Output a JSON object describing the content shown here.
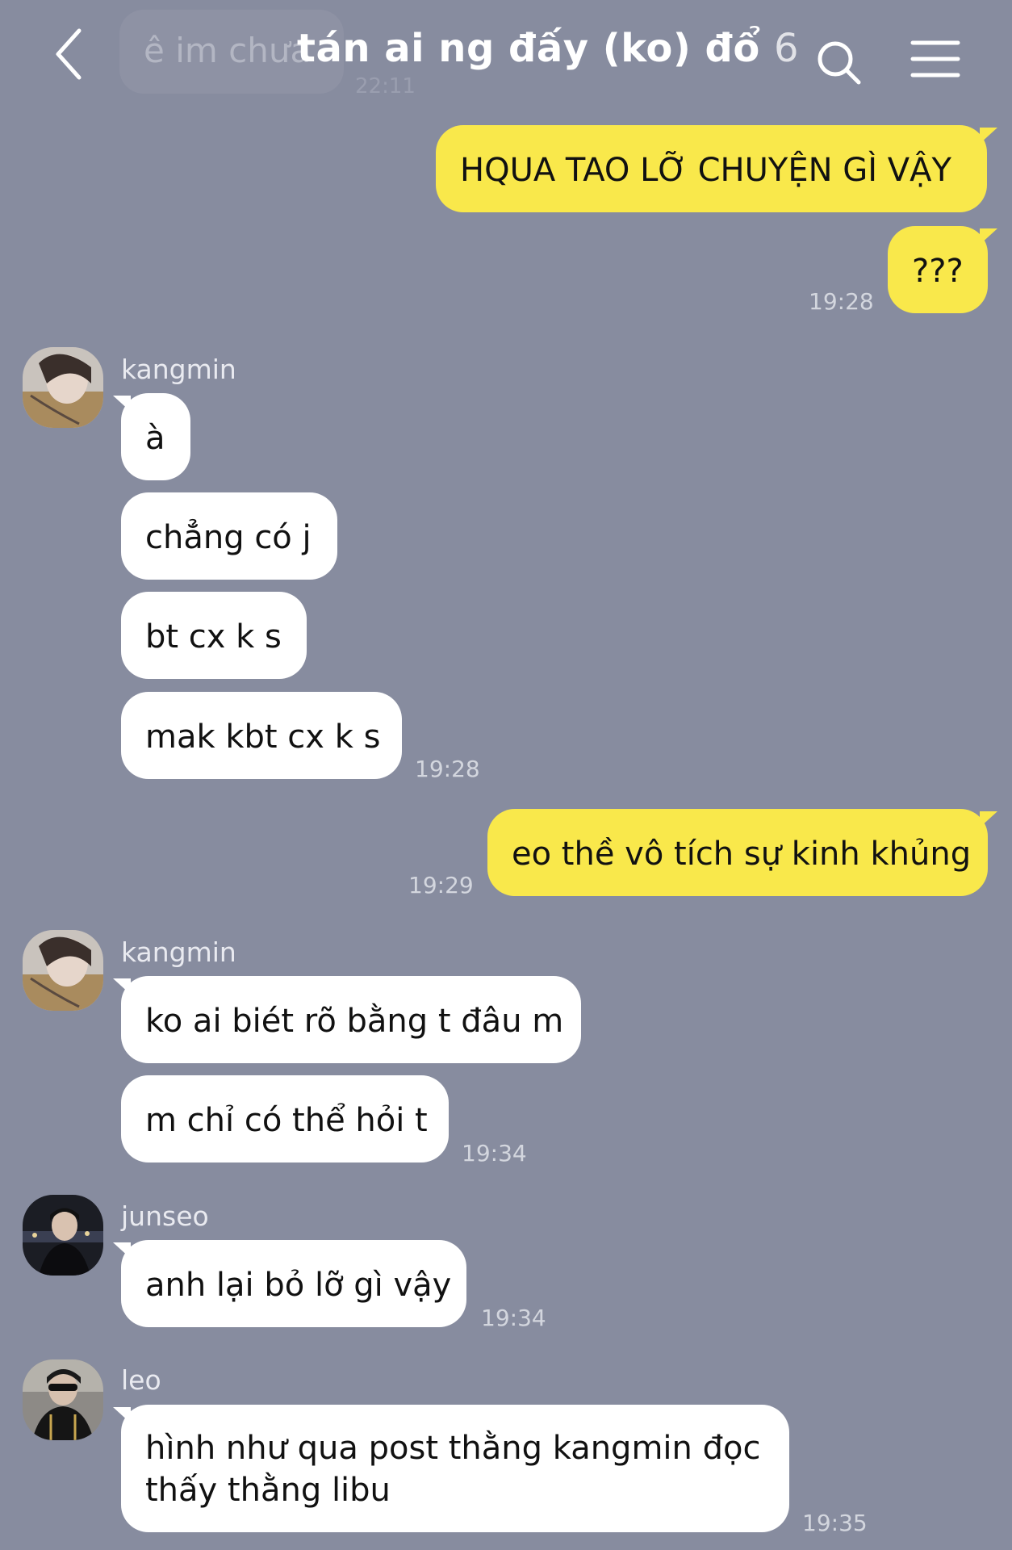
{
  "header": {
    "back_label": "<",
    "ghost_preview": "ê im chưa",
    "ghost_time": "22:11",
    "title": "tán ai ng đấy (ko) đổ",
    "member_count": "6"
  },
  "messages": {
    "m1": "HQUA TAO LỠ CHUYỆN GÌ VẬY",
    "m2": "???",
    "t1": "19:28",
    "n1": "kangmin",
    "m3": "à",
    "m4": "chẳng có j",
    "m5": "bt cx k s",
    "m6": "mak kbt cx k s",
    "t2": "19:28",
    "m7": "eo thề vô tích sự kinh khủng",
    "t3": "19:29",
    "n2": "kangmin",
    "m8": "ko ai biét rõ bằng t đâu m",
    "m9": "m chỉ có thể hỏi t",
    "t4": "19:34",
    "n3": "junseo",
    "m10": "anh lại bỏ lỡ gì vậy",
    "t5": "19:34",
    "n4": "leo",
    "m11a": "hình như qua post thằng kangmin đọc",
    "m11b": "thấy thằng libu",
    "t6": "19:35"
  },
  "colors": {
    "background": "#878c9f",
    "outgoing_bubble": "#f9e84b",
    "incoming_bubble": "#ffffff"
  },
  "icons": [
    "back-arrow-icon",
    "search-icon",
    "menu-icon"
  ]
}
